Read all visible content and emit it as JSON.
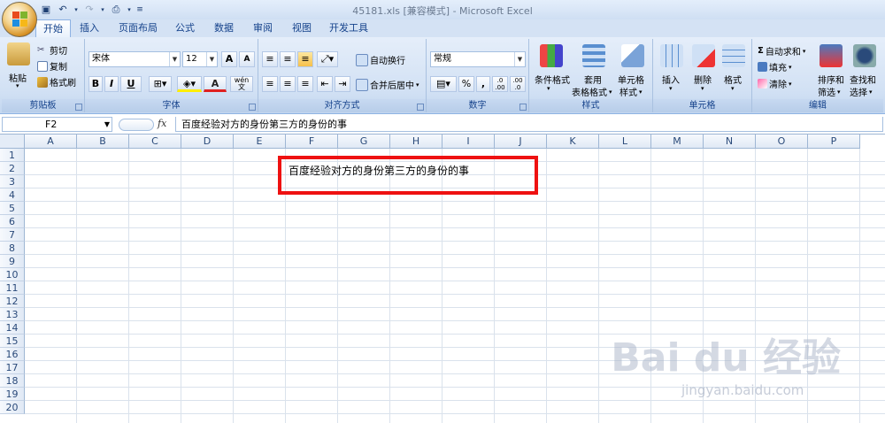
{
  "window": {
    "title": "45181.xls  [兼容模式] - Microsoft Excel"
  },
  "qat": {
    "items": [
      "save-icon",
      "undo-icon",
      "redo-icon",
      "print-preview-icon",
      "customize-icon"
    ]
  },
  "tabs": [
    "开始",
    "插入",
    "页面布局",
    "公式",
    "数据",
    "审阅",
    "视图",
    "开发工具"
  ],
  "ribbon": {
    "clipboard": {
      "paste": "粘贴",
      "cut": "剪切",
      "copy": "复制",
      "format_painter": "格式刷",
      "label": "剪贴板"
    },
    "font": {
      "name": "宋体",
      "size": "12",
      "bold": "B",
      "italic": "I",
      "underline": "U",
      "font_color": "A",
      "label": "字体",
      "grow": "A",
      "shrink": "A",
      "wen": "wén 文"
    },
    "alignment": {
      "wrap": "自动换行",
      "merge": "合并后居中",
      "label": "对齐方式"
    },
    "number": {
      "format": "常规",
      "percent": "%",
      "comma": ",",
      "inc": ".0 .00",
      "dec": ".00 .0",
      "label": "数字"
    },
    "styles": {
      "cond": "条件格式",
      "table_1": "套用",
      "table_2": "表格格式",
      "cell_1": "单元格",
      "cell_2": "样式",
      "label": "样式"
    },
    "cells": {
      "insert": "插入",
      "delete": "删除",
      "format": "格式",
      "label": "单元格"
    },
    "editing": {
      "autosum": "自动求和",
      "fill": "填充",
      "clear": "清除",
      "sort_1": "排序和",
      "sort_2": "筛选",
      "find_1": "查找和",
      "find_2": "选择",
      "label": "编辑"
    }
  },
  "formula_bar": {
    "name_box": "F2",
    "fx": "fx",
    "content": "百度经验对方的身份第三方的身份的事"
  },
  "columns": [
    "A",
    "B",
    "C",
    "D",
    "E",
    "F",
    "G",
    "H",
    "I",
    "J",
    "K",
    "L",
    "M",
    "N",
    "O",
    "P"
  ],
  "rows": [
    "1",
    "2",
    "3",
    "4",
    "5",
    "6",
    "7",
    "8",
    "9",
    "10",
    "11",
    "12",
    "13",
    "14",
    "15",
    "16",
    "17",
    "18",
    "19",
    "20"
  ],
  "cell_f2": "百度经验对方的身份第三方的身份的事",
  "watermark": {
    "brand": "Bai du 经验",
    "url": "jingyan.baidu.com"
  }
}
